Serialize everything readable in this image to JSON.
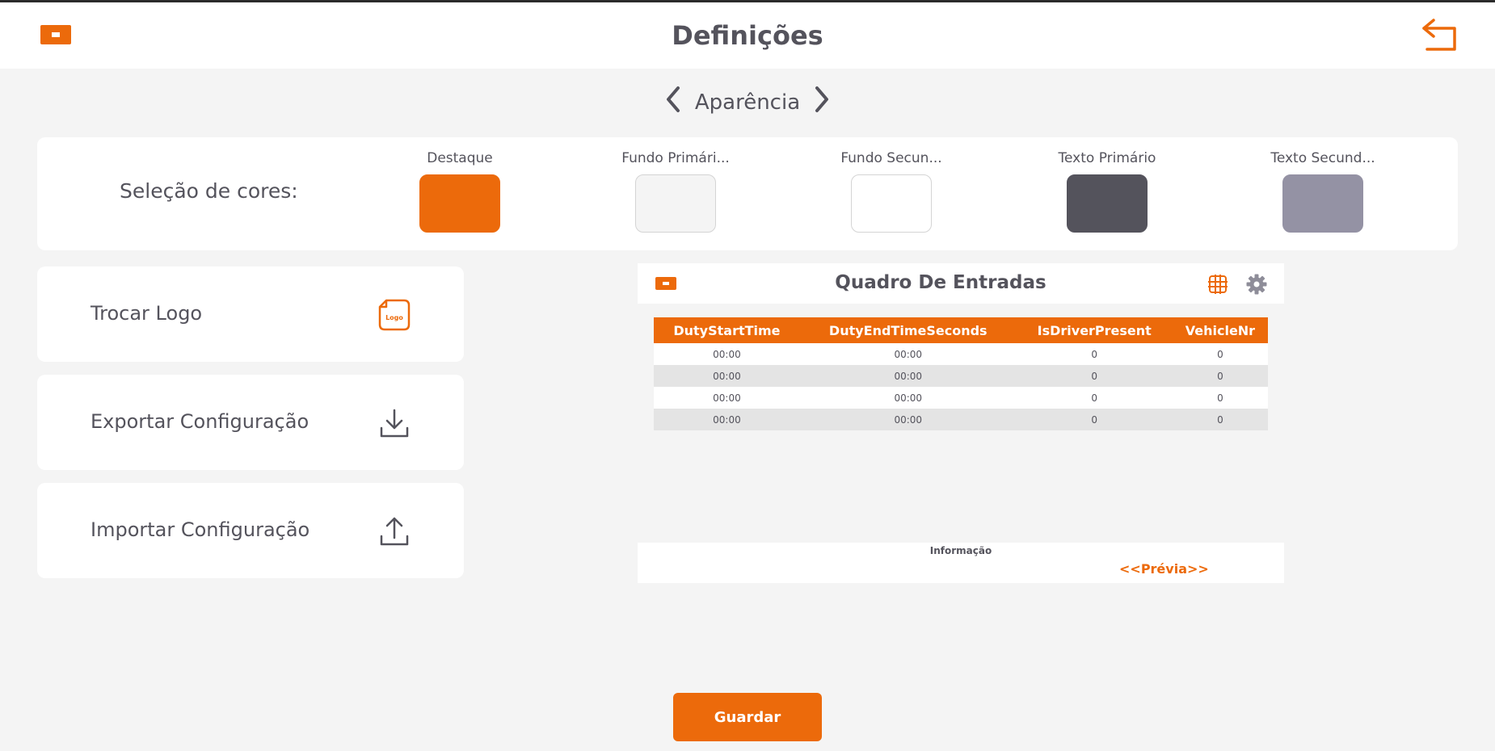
{
  "header": {
    "title": "Definições",
    "logo_icon": "logo-icon",
    "back_icon": "return-arrow-icon"
  },
  "section_nav": {
    "label": "Aparência",
    "prev_icon": "chevron-left-icon",
    "next_icon": "chevron-right-icon"
  },
  "colors": {
    "label": "Seleção de cores:",
    "swatches": [
      {
        "name": "Destaque",
        "color": "#ec6a0b"
      },
      {
        "name": "Fundo Primári...",
        "color": "#f4f4f4"
      },
      {
        "name": "Fundo Secun...",
        "color": "#ffffff"
      },
      {
        "name": "Texto Primário",
        "color": "#54535c"
      },
      {
        "name": "Texto Secund...",
        "color": "#9492a4"
      }
    ]
  },
  "actions": [
    {
      "label": "Trocar Logo",
      "icon": "logo-file-icon",
      "icon_text": "Logo"
    },
    {
      "label": "Exportar Configuração",
      "icon": "download-icon"
    },
    {
      "label": "Importar Configuração",
      "icon": "upload-icon"
    }
  ],
  "preview": {
    "title": "Quadro De Entradas",
    "columns": [
      "DutyStartTime",
      "DutyEndTimeSeconds",
      "IsDriverPresent",
      "VehicleNr"
    ],
    "rows": [
      [
        "00:00",
        "00:00",
        "0",
        "0"
      ],
      [
        "00:00",
        "00:00",
        "0",
        "0"
      ],
      [
        "00:00",
        "00:00",
        "0",
        "0"
      ],
      [
        "00:00",
        "00:00",
        "0",
        "0"
      ]
    ],
    "footer_label": "Informação",
    "footer_link": "<<Prévia>>",
    "grid_icon": "grid-icon",
    "settings_icon": "gear-icon"
  },
  "save_label": "Guardar",
  "accent": "#ec6a0b"
}
